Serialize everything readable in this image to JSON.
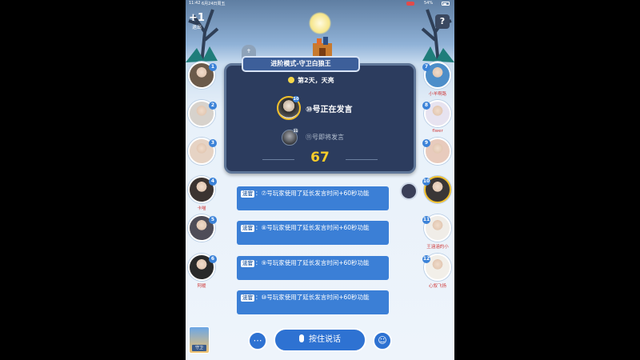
{
  "status_bar": {
    "time": "11:42",
    "date": "6月24日周五",
    "battery": "54%"
  },
  "top": {
    "exit_icon": "+1",
    "exit_label": "退出",
    "help_icon": "?",
    "tomb_mark": "✝"
  },
  "game": {
    "mode_title": "进阶模式-守卫白狼王",
    "day_text": "第2天，天亮",
    "speaker_text": "⑩号正在发言",
    "speaker_badge": "10",
    "next_text": "⑪号即将发言",
    "next_badge": "11",
    "countdown": "67"
  },
  "messages": [
    {
      "tag": "法官",
      "text": "：⑦号玩家使用了延长发言时间+60秒功能"
    },
    {
      "tag": "法官",
      "text": "：⑧号玩家使用了延长发言时间+60秒功能"
    },
    {
      "tag": "法官",
      "text": "：⑨号玩家使用了延长发言时间+60秒功能"
    },
    {
      "tag": "法官",
      "text": "：⑩号玩家使用了延长发言时间+60秒功能"
    }
  ],
  "players_left": [
    {
      "num": "1",
      "name": "",
      "color": "#6b5a4a"
    },
    {
      "num": "2",
      "name": "",
      "color": "#d7d2cc"
    },
    {
      "num": "3",
      "name": "",
      "color": "#e6d3c4"
    },
    {
      "num": "4",
      "name": "卡喵",
      "color": "#3b3330"
    },
    {
      "num": "5",
      "name": "",
      "color": "#4f4d58"
    },
    {
      "num": "6",
      "name": "阿暖",
      "color": "#2a2a2a"
    }
  ],
  "players_right": [
    {
      "num": "7",
      "name": "小羊啊路",
      "color": "#4d8ec9"
    },
    {
      "num": "8",
      "name": "flwer",
      "color": "#e7e3f0"
    },
    {
      "num": "9",
      "name": "",
      "color": "#e8cbbd"
    },
    {
      "num": "10",
      "name": "",
      "color": "#3a3636"
    },
    {
      "num": "11",
      "name": "王涵涵的小",
      "color": "#f0ede8"
    },
    {
      "num": "12",
      "name": "心叙飞扬",
      "color": "#f2efe9"
    }
  ],
  "bottom": {
    "talk_label": "按住说话",
    "chat_icon": "⋯",
    "emoji_icon": "☺",
    "badge_label": "守卫"
  },
  "colors": {
    "accent": "#2e72d2",
    "panel": "#2c3c5e",
    "countdown": "#f6cc2a"
  }
}
